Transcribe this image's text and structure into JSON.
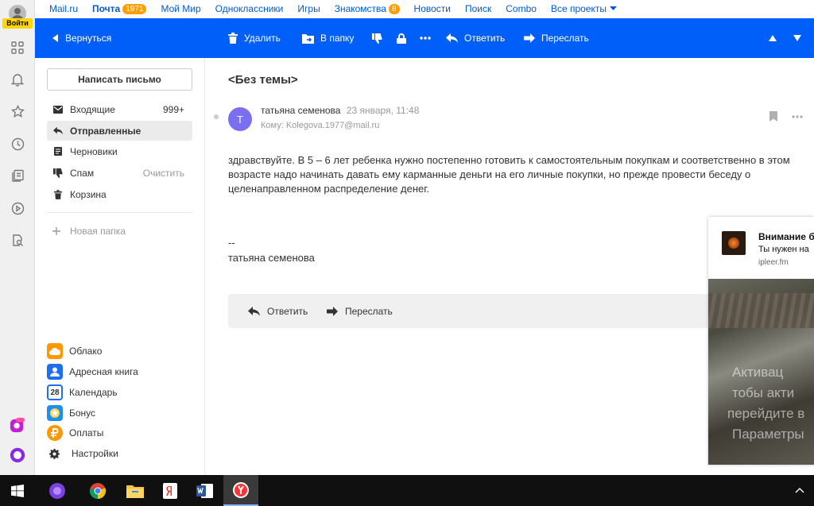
{
  "left_rail": {
    "login_label": "Войти",
    "icons": [
      "apps-grid-icon",
      "bell-icon",
      "star-icon",
      "clock-icon",
      "documents-icon",
      "play-icon",
      "search-doc-icon"
    ],
    "bottom_icons": [
      "marusia-app-icon",
      "alice-icon"
    ]
  },
  "topnav": {
    "links": [
      {
        "label": "Mail.ru"
      },
      {
        "label": "Почта",
        "badge": "1971",
        "bold": true
      },
      {
        "label": "Мой Мир"
      },
      {
        "label": "Одноклассники"
      },
      {
        "label": "Игры"
      },
      {
        "label": "Знакомства",
        "badge": "8"
      },
      {
        "label": "Новости"
      },
      {
        "label": "Поиск"
      },
      {
        "label": "Combo"
      },
      {
        "label": "Все проекты",
        "dropdown": true
      }
    ]
  },
  "toolbar": {
    "back_label": "Вернуться",
    "delete_label": "Удалить",
    "to_folder_label": "В папку",
    "reply_label": "Ответить",
    "forward_label": "Переслать",
    "icons": [
      "dislike-icon",
      "lock-icon",
      "more-icon",
      "arrow-up-icon",
      "arrow-down-icon"
    ]
  },
  "sidebar": {
    "compose_label": "Написать письмо",
    "folders": [
      {
        "label": "Входящие",
        "count": "999+",
        "icon": "inbox-icon"
      },
      {
        "label": "Отправленные",
        "icon": "sent-icon",
        "active": true
      },
      {
        "label": "Черновики",
        "icon": "drafts-icon"
      },
      {
        "label": "Спам",
        "action": "Очистить",
        "icon": "spam-icon"
      },
      {
        "label": "Корзина",
        "icon": "trash-icon"
      }
    ],
    "new_folder_label": "Новая папка",
    "services": [
      {
        "label": "Облако",
        "color": "#ff9800",
        "icon": "cloud-icon"
      },
      {
        "label": "Адресная книга",
        "color": "#1e6ff0",
        "icon": "contacts-icon"
      },
      {
        "label": "Календарь",
        "color": "#1e6ff0",
        "icon": "calendar-icon",
        "text": "28"
      },
      {
        "label": "Бонус",
        "color": "#1e8ff0",
        "icon": "bonus-icon"
      },
      {
        "label": "Оплаты",
        "color": "#ff9800",
        "icon": "payments-icon"
      },
      {
        "label": "Настройки",
        "icon": "gear-icon"
      }
    ]
  },
  "message": {
    "subject": "<Без темы>",
    "avatar_letter": "Т",
    "sender": "татьяна семенова",
    "date": "23 января, 11:48",
    "to": "Кому: Kolegova.1977@mail.ru",
    "body": "здравствуйте. В 5 – 6 лет ребенка нужно постепенно готовить к самостоятельным покупкам и соответственно в этом возрасте надо начинать давать ему карманные деньги на его личные покупки, но прежде провести беседу о целенаправленном распределение денег.",
    "signature_sep": "--",
    "signature_name": "татьяна семенова",
    "reply_label": "Ответить",
    "forward_label": "Переслать"
  },
  "notification": {
    "title": "Внимание б",
    "text": "Ты нужен на",
    "source": "ipleer.fm",
    "overlay_lines": [
      "Активац",
      "тобы акти",
      "перейдите в",
      "Параметры"
    ]
  },
  "taskbar": {
    "icons": [
      "windows-start-icon",
      "alice-icon",
      "chrome-icon",
      "file-explorer-icon",
      "yandex-icon",
      "word-icon",
      "yandex-browser-icon"
    ],
    "active_index": 6
  }
}
